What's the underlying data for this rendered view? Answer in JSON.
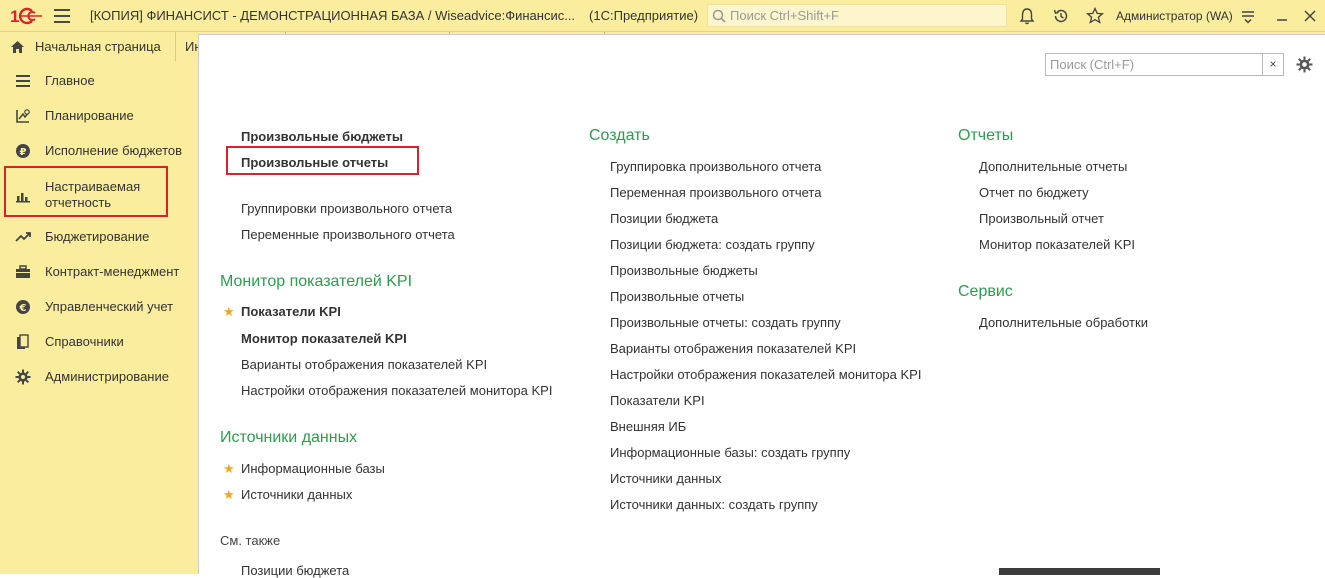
{
  "topbar": {
    "window_title": "[КОПИЯ] ФИНАНСИСТ - ДЕМОНСТРАЦИОННАЯ БАЗА / Wiseadvice:Финансис...",
    "app_name": "(1С:Предприятие)",
    "search_placeholder": "Поиск Ctrl+Shift+F",
    "user": "Администратор (WA)"
  },
  "tabs": {
    "home_label": "Начальная страница",
    "second_label": "Ин"
  },
  "sidebar": {
    "items": [
      {
        "label": "Главное",
        "icon": "list-icon"
      },
      {
        "label": "Планирование",
        "icon": "planning-icon"
      },
      {
        "label": "Исполнение бюджетов",
        "icon": "ruble-coin-icon"
      },
      {
        "label": "Настраиваемая отчетность",
        "icon": "bar-chart-icon"
      },
      {
        "label": "Бюджетирование",
        "icon": "trend-icon"
      },
      {
        "label": "Контракт-менеджмент",
        "icon": "briefcase-icon"
      },
      {
        "label": "Управленческий учет",
        "icon": "euro-coin-icon"
      },
      {
        "label": "Справочники",
        "icon": "books-icon"
      },
      {
        "label": "Администрирование",
        "icon": "gear-icon"
      }
    ],
    "active_line1": "Настраиваемая",
    "active_line2": "отчетность"
  },
  "content": {
    "search_placeholder": "Поиск (Ctrl+F)",
    "clear_label": "×",
    "col1": {
      "top_links": [
        "Произвольные бюджеты",
        "Произвольные отчеты"
      ],
      "sub_links": [
        "Группировки произвольного отчета",
        "Переменные произвольного отчета"
      ],
      "kpi_header": "Монитор показателей KPI",
      "kpi_links": [
        "Показатели KPI",
        "Монитор показателей KPI",
        "Варианты отображения показателей KPI",
        "Настройки отображения показателей монитора KPI"
      ],
      "sources_header": "Источники данных",
      "sources_links": [
        "Информационные базы",
        "Источники данных"
      ],
      "see_also": "См. также",
      "see_also_links": [
        "Позиции бюджета"
      ]
    },
    "col2": {
      "header": "Создать",
      "links": [
        "Группировка произвольного отчета",
        "Переменная произвольного отчета",
        "Позиции бюджета",
        "Позиции бюджета: создать группу",
        "Произвольные бюджеты",
        "Произвольные отчеты",
        "Произвольные отчеты: создать группу",
        "Варианты отображения показателей KPI",
        "Настройки отображения показателей монитора KPI",
        "Показатели KPI",
        "Внешняя ИБ",
        "Информационные базы: создать группу",
        "Источники данных",
        "Источники данных: создать группу"
      ]
    },
    "col3": {
      "reports_header": "Отчеты",
      "reports_links": [
        "Дополнительные отчеты",
        "Отчет по бюджету",
        "Произвольный отчет",
        "Монитор показателей KPI"
      ],
      "service_header": "Сервис",
      "service_links": [
        "Дополнительные обработки"
      ]
    }
  },
  "colors": {
    "accent_green": "#2e9b4f",
    "panel_yellow": "#fbed9e",
    "highlight_red": "#d9232a",
    "star": "#f2a81d"
  }
}
